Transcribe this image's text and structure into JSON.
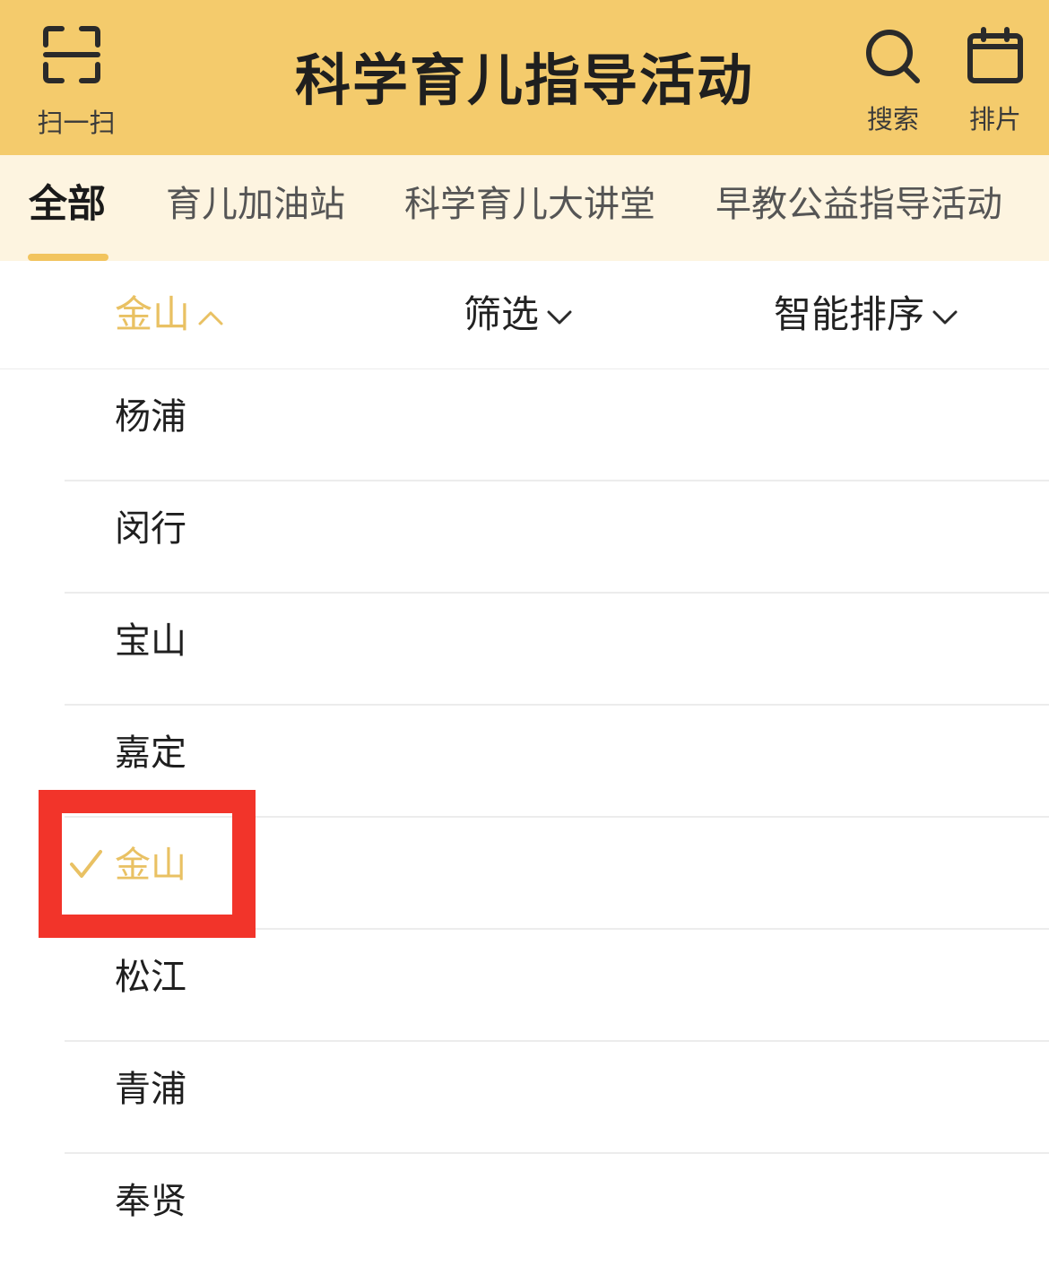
{
  "header": {
    "title": "科学育儿指导活动",
    "scan_label": "扫一扫",
    "search_label": "搜索",
    "schedule_label": "排片"
  },
  "tabs": [
    {
      "label": "全部",
      "active": true
    },
    {
      "label": "育儿加油站"
    },
    {
      "label": "科学育儿大讲堂"
    },
    {
      "label": "早教公益指导活动"
    }
  ],
  "filters": {
    "district": "金山",
    "filter": "筛选",
    "sort": "智能排序"
  },
  "districts": [
    {
      "name": "杨浦"
    },
    {
      "name": "闵行"
    },
    {
      "name": "宝山"
    },
    {
      "name": "嘉定"
    },
    {
      "name": "金山",
      "selected": true
    },
    {
      "name": "松江"
    },
    {
      "name": "青浦"
    },
    {
      "name": "奉贤"
    }
  ],
  "colors": {
    "header_bg": "#f4cb6c",
    "tab_bar_bg": "#fdf4e0",
    "accent": "#e9c163",
    "highlight_box": "#f2342a"
  },
  "icons": {
    "scan": "scan-icon",
    "search": "search-icon",
    "schedule": "calendar-icon",
    "dropdown": "chevron-down-icon",
    "dropdown_open": "chevron-up-icon",
    "selected": "check-icon"
  }
}
